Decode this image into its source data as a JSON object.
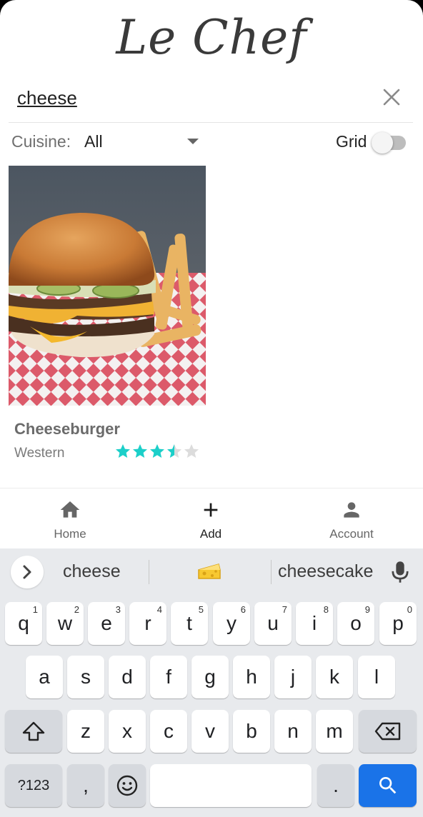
{
  "app": {
    "title": "Le Chef"
  },
  "search": {
    "value": "cheese"
  },
  "filters": {
    "cuisine_label": "Cuisine:",
    "cuisine_value": "All",
    "grid_label": "Grid",
    "grid_enabled": false
  },
  "results": [
    {
      "name": "Cheeseburger",
      "cuisine": "Western",
      "rating": 3.5,
      "max_rating": 5
    }
  ],
  "bottom_nav": [
    {
      "label": "Home",
      "icon": "home-icon"
    },
    {
      "label": "Add",
      "icon": "plus-icon"
    },
    {
      "label": "Account",
      "icon": "person-icon"
    }
  ],
  "keyboard": {
    "suggestions": [
      "cheese",
      "cheesecake"
    ],
    "row1": [
      {
        "k": "q",
        "n": "1"
      },
      {
        "k": "w",
        "n": "2"
      },
      {
        "k": "e",
        "n": "3"
      },
      {
        "k": "r",
        "n": "4"
      },
      {
        "k": "t",
        "n": "5"
      },
      {
        "k": "y",
        "n": "6"
      },
      {
        "k": "u",
        "n": "7"
      },
      {
        "k": "i",
        "n": "8"
      },
      {
        "k": "o",
        "n": "9"
      },
      {
        "k": "p",
        "n": "0"
      }
    ],
    "row2": [
      "a",
      "s",
      "d",
      "f",
      "g",
      "h",
      "j",
      "k",
      "l"
    ],
    "row3": [
      "z",
      "x",
      "c",
      "v",
      "b",
      "n",
      "m"
    ],
    "symbols_key": "?123",
    "comma_key": ",",
    "period_key": "."
  },
  "colors": {
    "star_filled": "#1ccfc9",
    "star_empty": "#dcdcdc",
    "accent_blue": "#1a73e8"
  }
}
